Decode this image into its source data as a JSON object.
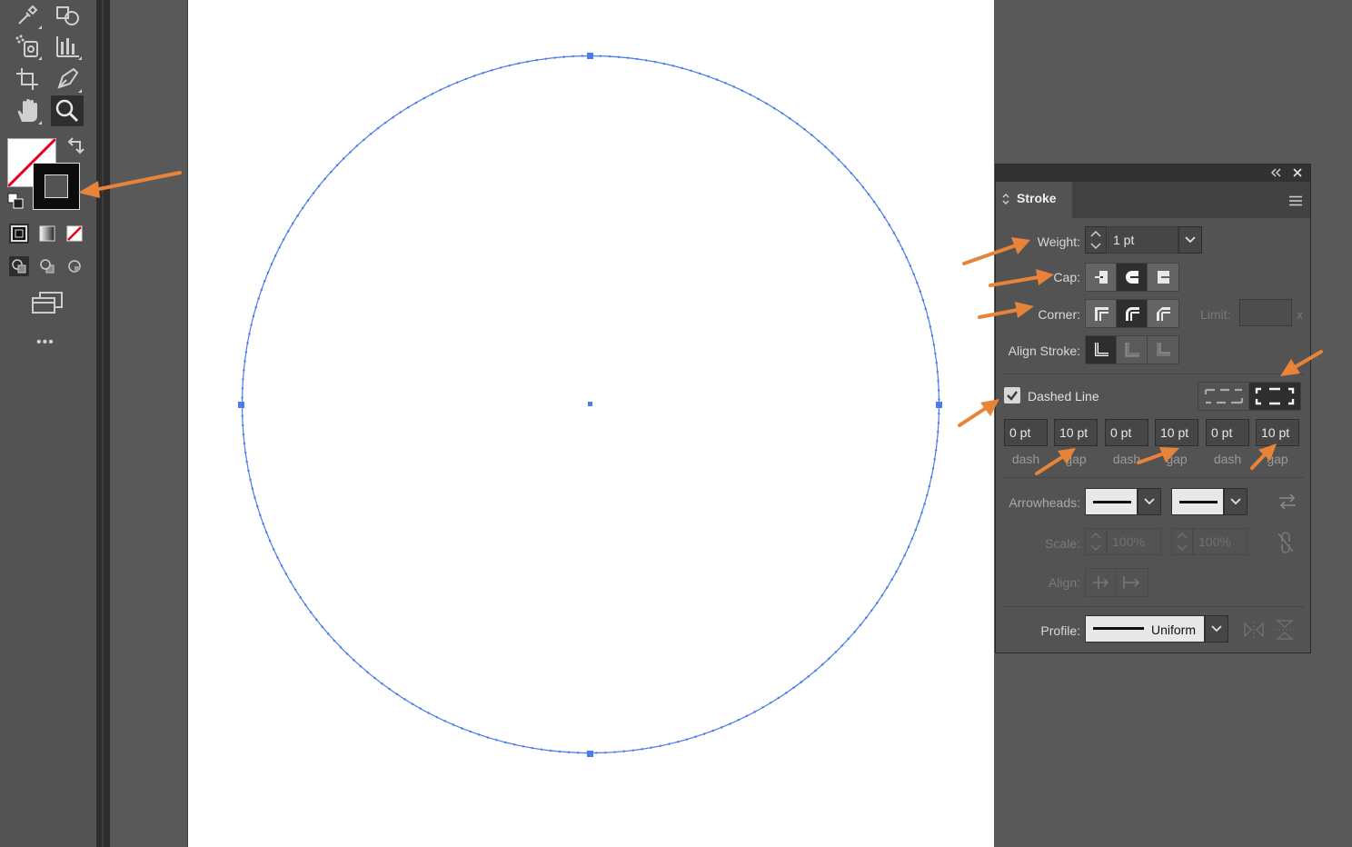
{
  "toolbar": {
    "tools": [
      {
        "name": "eyedropper-icon"
      },
      {
        "name": "shape-builder-icon"
      },
      {
        "name": "symbol-sprayer-icon"
      },
      {
        "name": "column-graph-icon"
      },
      {
        "name": "artboard-icon"
      },
      {
        "name": "pen-icon"
      },
      {
        "name": "hand-icon"
      },
      {
        "name": "zoom-icon",
        "active": true
      }
    ],
    "more_label": "•••"
  },
  "stroke_panel": {
    "title": "Stroke",
    "collapse_icon": "double-chevron-left-icon",
    "close_icon": "close-icon",
    "menu_icon": "hamburger-menu-icon",
    "weight_label": "Weight:",
    "weight_value": "1 pt",
    "cap_label": "Cap:",
    "cap_selected": "round",
    "corner_label": "Corner:",
    "corner_selected": "round",
    "limit_label": "Limit:",
    "limit_suffix": "x",
    "align_stroke_label": "Align Stroke:",
    "align_selected": "center",
    "dashed_line_label": "Dashed Line",
    "dashed_line_checked": true,
    "dash_mode_selected": "align-to-corners",
    "dashes": [
      {
        "value": "0 pt",
        "label": "dash"
      },
      {
        "value": "10 pt",
        "label": "gap"
      },
      {
        "value": "0 pt",
        "label": "dash"
      },
      {
        "value": "10 pt",
        "label": "gap"
      },
      {
        "value": "0 pt",
        "label": "dash"
      },
      {
        "value": "10 pt",
        "label": "gap"
      }
    ],
    "arrowheads_label": "Arrowheads:",
    "scale_label": "Scale:",
    "scale_start": "100%",
    "scale_end": "100%",
    "align_label": "Align:",
    "profile_label": "Profile:",
    "profile_value": "Uniform"
  },
  "colors": {
    "selection": "#4b7bec",
    "annotation_arrow": "#e8833a",
    "panel_bg": "#535353",
    "artboard": "#ffffff"
  }
}
